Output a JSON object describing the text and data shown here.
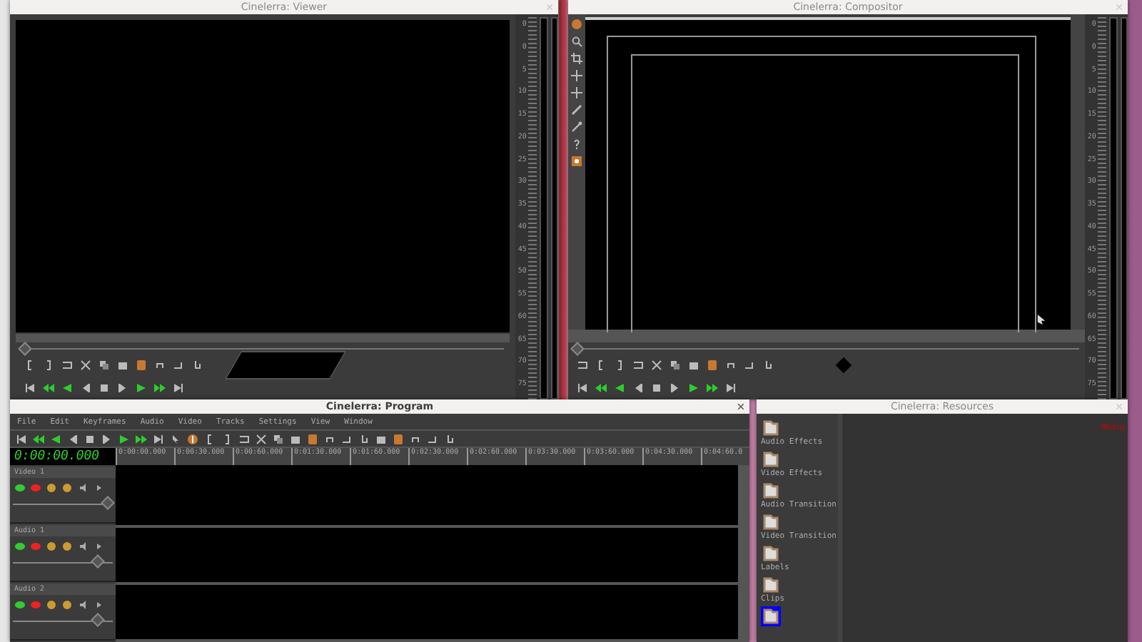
{
  "viewer": {
    "title": "Cinelerra: Viewer",
    "focused": false,
    "position": {
      "level": 0
    },
    "meter_labels": [
      "0",
      "0",
      "5",
      "10",
      "15",
      "20",
      "25",
      "30",
      "35",
      "40",
      "45",
      "50",
      "55",
      "60",
      "65",
      "70",
      "75"
    ]
  },
  "compositor": {
    "title": "Cinelerra: Compositor",
    "focused": false,
    "position": {
      "level": 0
    },
    "meter_labels": [
      "0",
      "0",
      "5",
      "10",
      "15",
      "20",
      "25",
      "30",
      "35",
      "40",
      "45",
      "50",
      "55",
      "60",
      "65",
      "70",
      "75"
    ]
  },
  "program": {
    "title": "Cinelerra: Program",
    "focused": true,
    "menu": [
      "File",
      "Edit",
      "Keyframes",
      "Audio",
      "Video",
      "Tracks",
      "Settings",
      "View",
      "Window"
    ],
    "clock": "0:00:00.000",
    "ruler": [
      "0:00:00.000",
      "0:00:30.000",
      "0:00:60.000",
      "0:01:30.000",
      "0:01:60.000",
      "0:02:30.000",
      "0:02:60.000",
      "0:03:30.000",
      "0:03:60.000",
      "0:04:30.000",
      "0:04:60.0"
    ],
    "tracks": [
      {
        "name": "Video 1",
        "level": 0.95
      },
      {
        "name": "Audio 1",
        "level": 0.85
      },
      {
        "name": "Audio 2",
        "level": 0.85
      }
    ]
  },
  "resources": {
    "title": "Cinelerra: Resources",
    "focused": false,
    "folders": [
      {
        "label": "Audio Effects",
        "selected": false
      },
      {
        "label": "Video Effects",
        "selected": false
      },
      {
        "label": "Audio Transition",
        "selected": false
      },
      {
        "label": "Video Transition",
        "selected": false
      },
      {
        "label": "Labels",
        "selected": false
      },
      {
        "label": "Clips",
        "selected": false
      },
      {
        "selected": true
      }
    ],
    "media_label": "Media"
  }
}
